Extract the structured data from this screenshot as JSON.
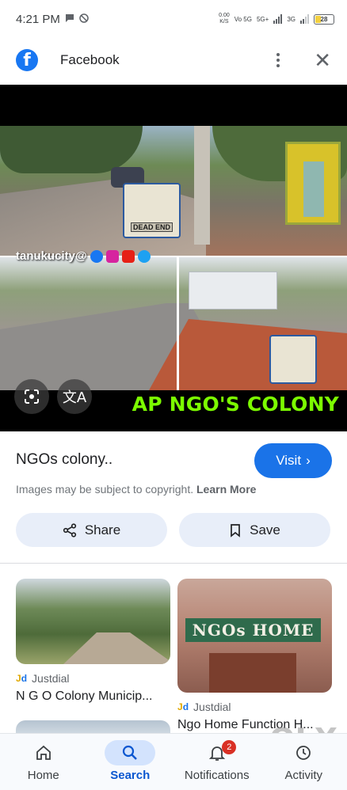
{
  "status_bar": {
    "time": "4:21 PM",
    "net_speed_value": "0.00",
    "net_speed_unit": "K/S",
    "volte": "Vo 5G",
    "network_5g": "5G+",
    "network_3g": "3G",
    "battery": "28"
  },
  "top_bar": {
    "site_name": "Facebook"
  },
  "preview": {
    "watermark": "tanukucity@",
    "caption": "AP NGO'S COLONY",
    "sign_top_dead_end": "DEAD END",
    "translate_glyph": "文A"
  },
  "info": {
    "title": "NGOs colony..",
    "visit_label": "Visit",
    "copyright_text": "Images may be subject to copyright.",
    "learn_more": "Learn More",
    "share_label": "Share",
    "save_label": "Save"
  },
  "results": [
    {
      "source": "Justdial",
      "title": "N G O Colony Municip..."
    },
    {
      "source": "Justdial",
      "title": "Ngo Home Function H...",
      "sign_text": "NGOs HOME"
    }
  ],
  "bottom_nav": {
    "items": [
      {
        "label": "Home",
        "icon": "home-icon"
      },
      {
        "label": "Search",
        "icon": "search-icon",
        "active": true
      },
      {
        "label": "Notifications",
        "icon": "bell-icon",
        "badge": "2"
      },
      {
        "label": "Activity",
        "icon": "activity-icon"
      }
    ]
  },
  "overlay_logo": "OLX",
  "colors": {
    "accent": "#1a73e8",
    "caption_green": "#7CFC00",
    "chip_bg": "#e8eef9",
    "nav_active_bg": "#d3e3fd",
    "badge_red": "#d93025"
  }
}
